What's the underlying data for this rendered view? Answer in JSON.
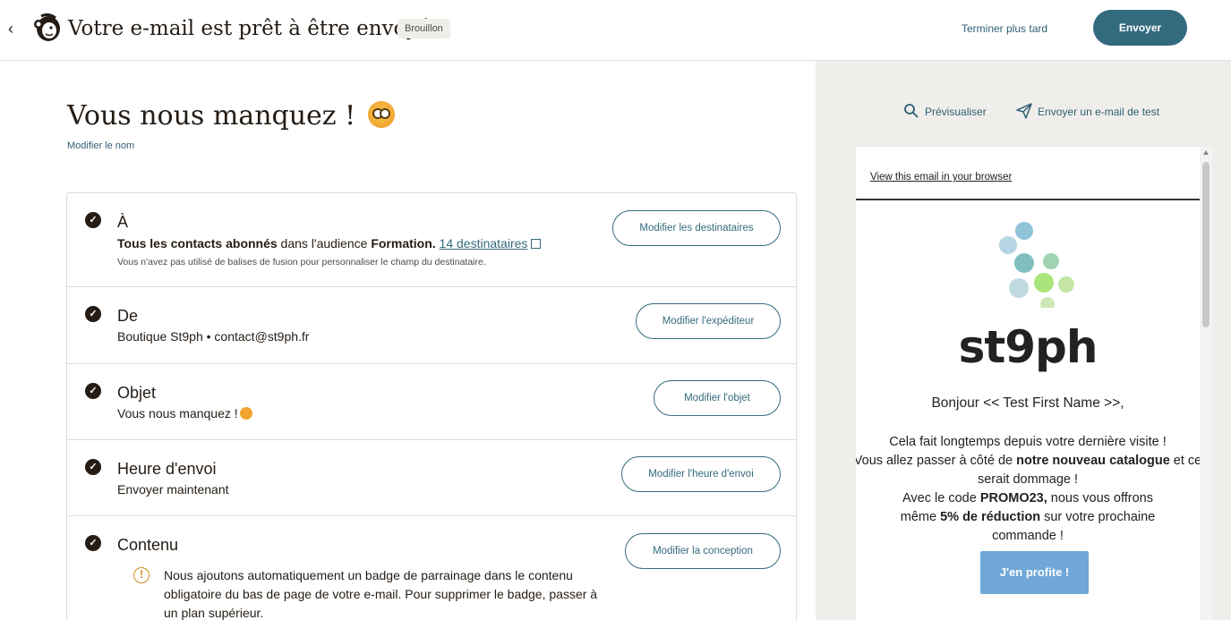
{
  "topbar": {
    "back_icon": "chevron-left-icon",
    "logo": "mailchimp-freddie-logo",
    "title": "Votre e-mail est prêt à être envoyé !",
    "status_badge": "Brouillon",
    "later_label": "Terminer plus tard",
    "send_label": "Envoyer",
    "send_color": "#346a7e"
  },
  "campaign": {
    "name": "Vous nous manquez !",
    "rename_label": "Modifier le nom"
  },
  "checklist": {
    "to": {
      "title": "À",
      "bold_segment": "Tous les contacts abonnés",
      "mid_text": " dans l'audience ",
      "audience": "Formation.",
      "recipients_link": "14 destinataires",
      "note": "Vous n'avez pas utilisé de balises de fusion pour personnaliser le champ du destinataire.",
      "button": "Modifier les destinataires"
    },
    "from": {
      "title": "De",
      "desc": "Boutique St9ph  •  contact@st9ph.fr",
      "button": "Modifier l'expéditeur"
    },
    "subject": {
      "title": "Objet",
      "desc": "Vous nous manquez !",
      "button": "Modifier l'objet"
    },
    "send_time": {
      "title": "Heure d'envoi",
      "desc": "Envoyer maintenant",
      "button": "Modifier l'heure d'envoi"
    },
    "content": {
      "title": "Contenu",
      "warning": "Nous ajoutons automatiquement un badge de parrainage dans le contenu obligatoire du bas de page de votre e-mail. Pour supprimer le badge, passer à un plan supérieur.",
      "button": "Modifier la conception"
    }
  },
  "preview_panel": {
    "preview_label": "Prévisualiser",
    "test_label": "Envoyer un e-mail de test",
    "email": {
      "browser_link": "View this email in your browser",
      "brand": "st9ph",
      "greeting": "Bonjour << Test First Name >>,",
      "line1": "Cela fait longtemps depuis votre dernière visite !",
      "line2a": "Vous allez passer à côté de ",
      "line2b": "notre nouveau catalogue",
      "line2c": " et ce serait dommage !",
      "line3a": "Avec le code ",
      "line3b": "PROMO23,",
      "line3c": " nous vous offrons même ",
      "line3d": "5% de réduction",
      "line3e": " sur votre prochaine commande !",
      "cta": "J'en profite !",
      "cta_color": "#6fa7d8"
    }
  }
}
